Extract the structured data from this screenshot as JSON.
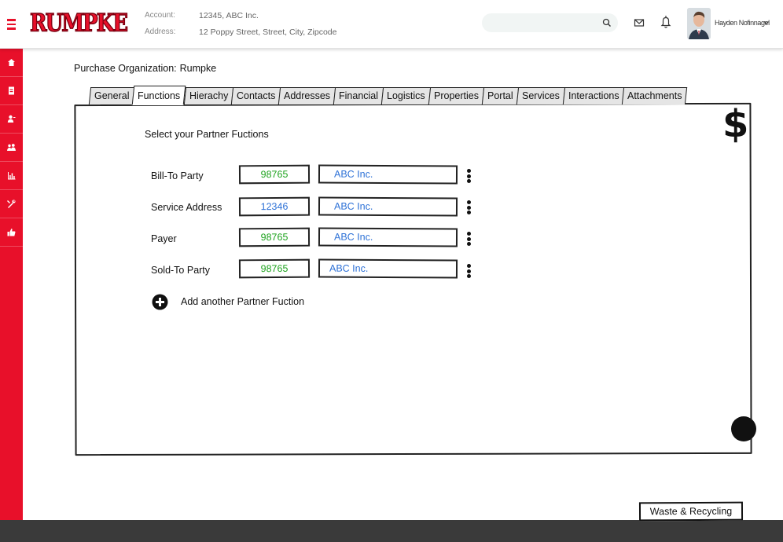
{
  "brand": {
    "logo_text": "RUMPKE",
    "accent_color": "#e8102a"
  },
  "header": {
    "account_label": "Account:",
    "account_value": "12345, ABC Inc.",
    "address_label": "Address:",
    "address_value": "12 Poppy Street, Street, City, Zipcode",
    "search_placeholder": "",
    "user_name": "Hayden Nofinnagel"
  },
  "sidebar": {
    "items": [
      {
        "icon": "home-icon"
      },
      {
        "icon": "document-icon"
      },
      {
        "icon": "user-icon"
      },
      {
        "icon": "team-icon"
      },
      {
        "icon": "bar-chart-icon"
      },
      {
        "icon": "tools-icon"
      },
      {
        "icon": "thumbs-up-icon"
      }
    ]
  },
  "main": {
    "org_label": "Purchase Organization:",
    "org_value": "Rumpke",
    "tabs": [
      {
        "label": "General"
      },
      {
        "label": "Functions",
        "active": true
      },
      {
        "label": "Hierachy"
      },
      {
        "label": "Contacts"
      },
      {
        "label": "Addresses"
      },
      {
        "label": "Financial"
      },
      {
        "label": "Logistics"
      },
      {
        "label": "Properties"
      },
      {
        "label": "Portal"
      },
      {
        "label": "Services"
      },
      {
        "label": "Interactions"
      },
      {
        "label": "Attachments"
      }
    ],
    "currency_symbol": "$",
    "section_title": "Select your Partner Fuctions",
    "partner_functions": [
      {
        "label": "Bill-To Party",
        "code": "98765",
        "code_color": "#1fa31f",
        "name": "ABC Inc."
      },
      {
        "label": "Service Address",
        "code": "12346",
        "code_color": "#2a6fd6",
        "name": "ABC Inc."
      },
      {
        "label": "Payer",
        "code": "98765",
        "code_color": "#1fa31f",
        "name": "ABC Inc."
      },
      {
        "label": "Sold-To Party",
        "code": "98765",
        "code_color": "#1fa31f",
        "name": "ABC Inc."
      }
    ],
    "add_label": "Add another Partner Fuction"
  },
  "footer": {
    "waste_button_label": "Waste & Recycling"
  }
}
